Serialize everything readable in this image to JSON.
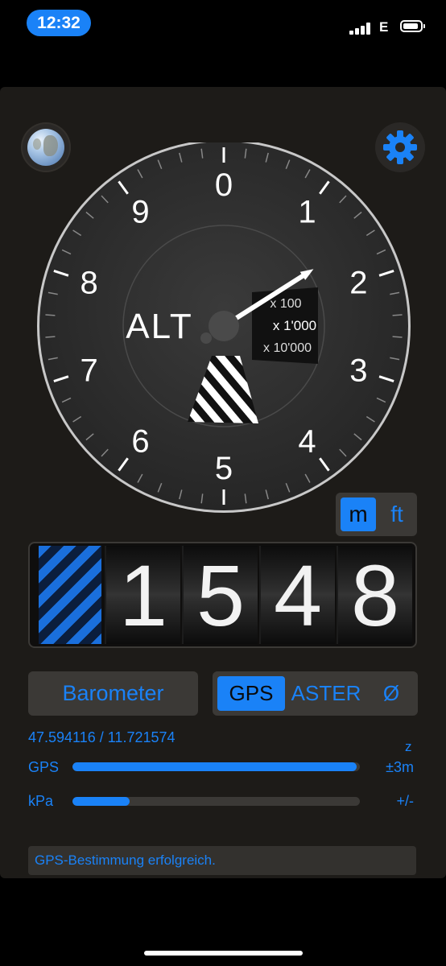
{
  "status_bar": {
    "time": "12:32",
    "network": "E"
  },
  "icons": {
    "globe": "globe-icon",
    "settings": "gear-icon"
  },
  "colors": {
    "accent": "#1a82f7",
    "panel": "#1d1b18",
    "control": "#3b3936"
  },
  "gauge": {
    "dial_numbers": [
      "0",
      "1",
      "2",
      "3",
      "4",
      "5",
      "6",
      "7",
      "8",
      "9"
    ],
    "label": "ALT",
    "scale_labels": [
      "x 100",
      "x 1'000",
      "x 10'000"
    ],
    "needle_value": 1.6
  },
  "units": {
    "metric": "m",
    "imperial": "ft",
    "selected": "m"
  },
  "counter": {
    "digits": [
      "1",
      "5",
      "4",
      "8"
    ]
  },
  "controls": {
    "barometer": "Barometer",
    "sources": [
      "GPS",
      "ASTER",
      "Ø"
    ],
    "selected_source": "GPS"
  },
  "readouts": {
    "coordinates": "47.594116 / 11.721574",
    "z_label": "z",
    "gps": {
      "label": "GPS",
      "value": "±3m",
      "level": 0.99
    },
    "kpa": {
      "label": "kPa",
      "value": "+/-",
      "level": 0.2
    }
  },
  "message": "GPS-Bestimmung erfolgreich."
}
